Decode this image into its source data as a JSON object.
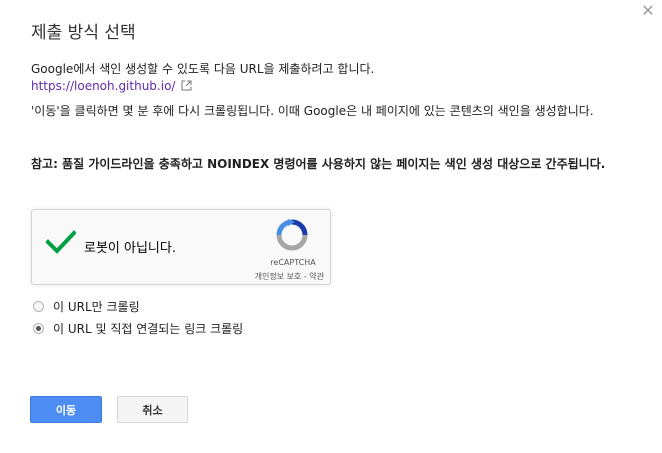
{
  "dialog": {
    "title": "제출 방식 선택",
    "intro": "Google에서 색인 생성할 수 있도록 다음 URL을 제출하려고 합니다.",
    "url": "https://loenoh.github.io/",
    "explanation": "'이동'을 클릭하면 몇 분 후에 다시 크롤링됩니다. 이때 Google은 내 페이지에 있는 콘텐츠의 색인을 생성합니다.",
    "note": "참고: 품질 가이드라인을 충족하고 NOINDEX 명령어를 사용하지 않는 페이지는 색인 생성 대상으로 간주됩니다."
  },
  "recaptcha": {
    "label": "로봇이 아닙니다.",
    "brand": "reCAPTCHA",
    "terms": "개인정보 보호 - 약관",
    "checked": true
  },
  "options": [
    {
      "label": "이 URL만 크롤링",
      "selected": false
    },
    {
      "label": "이 URL 및 직접 연결되는 링크 크롤링",
      "selected": true
    }
  ],
  "buttons": {
    "primary": "이동",
    "cancel": "취소"
  },
  "icons": {
    "close": "close-icon",
    "external": "external-link-icon",
    "check": "checkmark-icon",
    "recaptcha": "recaptcha-logo-icon"
  },
  "colors": {
    "primary_button": "#4d8cf2",
    "link": "#5e2bab",
    "check": "#029e44"
  }
}
